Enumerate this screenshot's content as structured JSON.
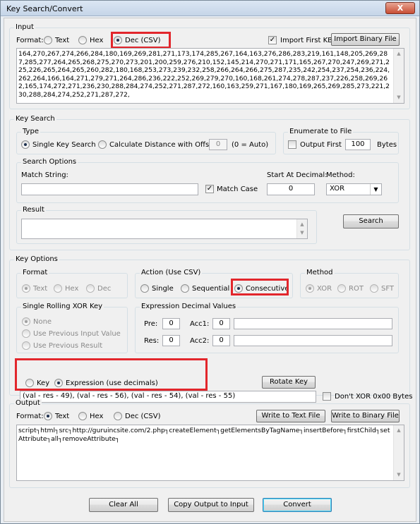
{
  "window": {
    "title": "Key Search/Convert",
    "close_label": "X"
  },
  "input": {
    "legend": "Input",
    "format_label": "Format:",
    "formats": [
      "Text",
      "Hex",
      "Dec (CSV)"
    ],
    "format_selected": "Dec (CSV)",
    "import_first_kb_label": "Import First KB",
    "import_first_kb_checked": true,
    "import_binary_label": "Import Binary File",
    "text": "164,270,267,274,266,284,180,169,269,281,271,173,174,285,267,164,163,276,286,283,219,161,148,205,269,287,285,277,264,265,268,275,270,273,201,200,259,276,210,152,145,214,270,271,171,165,267,270,247,269,271,225,226,265,264,265,260,282,180,168,253,273,239,232,258,266,264,266,275,287,235,242,254,237,254,236,224,262,264,166,164,271,279,271,264,286,236,222,252,269,279,270,160,168,261,274,278,287,237,226,258,269,262,165,174,272,271,236,230,288,284,274,252,271,287,272,160,163,259,271,167,180,169,265,269,285,273,221,230,288,284,274,252,271,287,272,"
  },
  "key_search": {
    "legend": "Key Search",
    "type_legend": "Type",
    "single_label": "Single Key Search",
    "distance_label": "Calculate Distance with Offset:",
    "offset_value": "0",
    "auto_note": "(0 = Auto)",
    "type_selected": "single",
    "enumerate_legend": "Enumerate to File",
    "output_first_label": "Output First",
    "output_first_checked": false,
    "output_first_value": "100",
    "bytes_label": "Bytes",
    "search_options_legend": "Search Options",
    "match_string_label": "Match String:",
    "match_string_value": "",
    "match_case_label": "Match Case",
    "match_case_checked": true,
    "start_at_label": "Start At Decimal:",
    "start_at_value": "0",
    "method_label": "Method:",
    "method_value": "XOR",
    "result_legend": "Result",
    "result_value": "",
    "search_button": "Search"
  },
  "key_options": {
    "legend": "Key Options",
    "format_legend": "Format",
    "formats": [
      "Text",
      "Hex",
      "Dec"
    ],
    "action_legend": "Action (Use CSV)",
    "actions": [
      "Single",
      "Sequential",
      "Consecutive"
    ],
    "action_selected": "Consecutive",
    "method_legend": "Method",
    "methods": [
      "XOR",
      "ROT",
      "SFT"
    ],
    "rolling_legend": "Single Rolling XOR Key",
    "rolling_options": [
      "None",
      "Use Previous Input Value",
      "Use Previous Result"
    ],
    "expr_legend": "Expression Decimal Values",
    "pre_label": "Pre:",
    "pre_value": "0",
    "acc1_label": "Acc1:",
    "acc1_value": "0",
    "res_label": "Res:",
    "res_value": "0",
    "acc2_label": "Acc2:",
    "acc2_value": "0",
    "key_radio_label": "Key",
    "expression_radio_label": "Expression (use decimals)",
    "key_mode_selected": "expression",
    "rotate_key_button": "Rotate Key",
    "expression_value": "(val - res - 49), (val - res - 56), (val - res - 54), (val - res - 55)",
    "dont_xor_label": "Don't XOR 0x00 Bytes",
    "dont_xor_checked": false
  },
  "output": {
    "legend": "Output",
    "format_label": "Format:",
    "formats": [
      "Text",
      "Hex",
      "Dec (CSV)"
    ],
    "format_selected": "Text",
    "write_text_button": "Write to Text File",
    "write_binary_button": "Write to Binary File",
    "text": "script┐html┐src┐http://guruincsite.com/2.php┐createElement┐getElementsByTagName┐insertBefore┐firstChild┐setAttribute┐all┐removeAttribute┐"
  },
  "buttons": {
    "clear_all": "Clear All",
    "copy_output": "Copy Output to Input",
    "convert": "Convert"
  },
  "colors": {
    "highlight": "#e2262c",
    "window_bg": "#f0f0f0",
    "title_gradient_top": "#dbe6f3"
  }
}
